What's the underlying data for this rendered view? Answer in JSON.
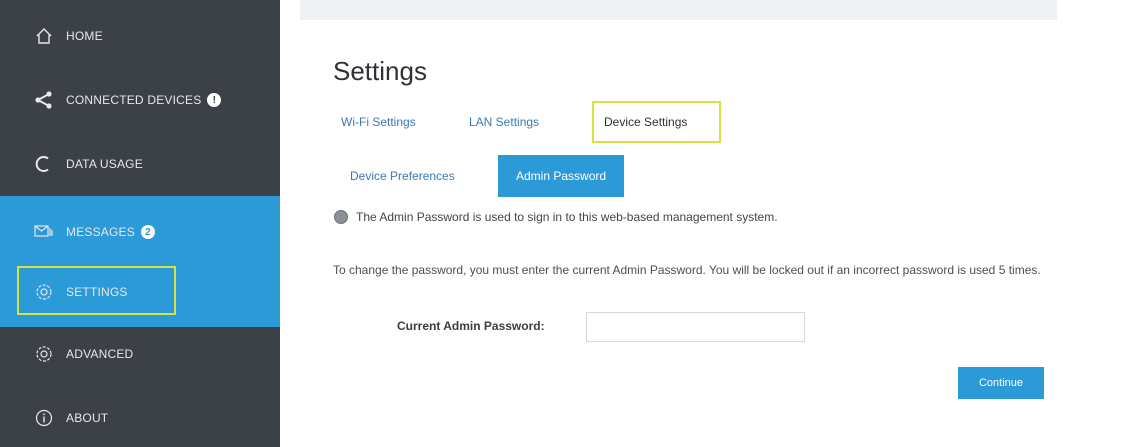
{
  "sidebar": {
    "items": [
      {
        "label": "HOME",
        "icon": "home-icon",
        "badge": ""
      },
      {
        "label": "CONNECTED DEVICES",
        "icon": "share-icon",
        "badge": "!"
      },
      {
        "label": "DATA USAGE",
        "icon": "data-usage-icon",
        "badge": ""
      },
      {
        "label": "MESSAGES",
        "icon": "message-icon",
        "badge": "2"
      },
      {
        "label": "SETTINGS",
        "icon": "gear-icon",
        "badge": ""
      },
      {
        "label": "ADVANCED",
        "icon": "gear-icon",
        "badge": ""
      },
      {
        "label": "ABOUT",
        "icon": "info-icon",
        "badge": ""
      }
    ],
    "active_item": "SETTINGS",
    "colors": {
      "background": "#3b4146",
      "accent": "#2d9ad8",
      "highlight": "#d7e242"
    }
  },
  "main": {
    "title": "Settings",
    "tabs": [
      {
        "label": "Wi-Fi Settings"
      },
      {
        "label": "LAN Settings"
      },
      {
        "label": "Device Settings",
        "selected": true
      }
    ],
    "subtabs": [
      {
        "label": "Device Preferences"
      },
      {
        "label": "Admin Password",
        "selected": true
      }
    ],
    "info_text": "The Admin Password is used to sign in to this web-based management system.",
    "help_text": "To change the password, you must enter the current Admin Password. You will be locked out if an incorrect password is used 5 times.",
    "current_password": {
      "label": "Current Admin Password:",
      "value": "",
      "placeholder": ""
    },
    "continue_label": "Continue"
  }
}
